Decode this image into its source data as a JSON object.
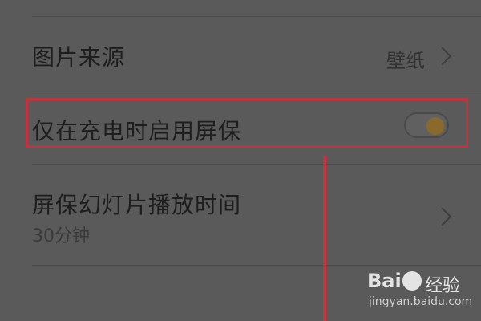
{
  "settings": {
    "image_source": {
      "label": "图片来源",
      "value": "壁纸"
    },
    "charge_only": {
      "label": "仅在充电时启用屏保",
      "toggle_on": true
    },
    "slideshow_time": {
      "label": "屏保幻灯片播放时间",
      "value": "30分钟"
    }
  },
  "watermark": {
    "brand": "Bai",
    "suffix": "经验",
    "url": "jingyan.baidu.com"
  },
  "colors": {
    "background": "#5a5a5a",
    "highlight": "#c5323d",
    "toggle_knob": "#8a6a2c"
  },
  "icons": [
    "chevron-right-icon",
    "toggle-switch",
    "baidu-paw-icon"
  ]
}
